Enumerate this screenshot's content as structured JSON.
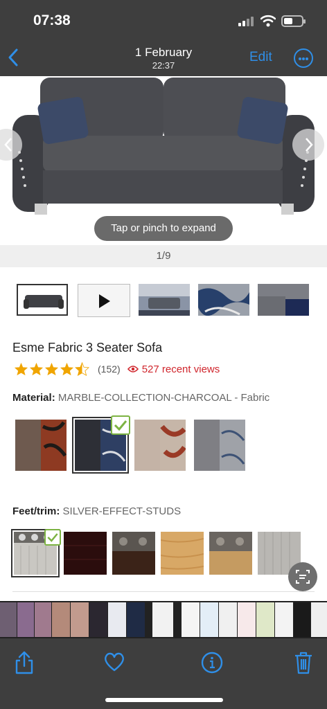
{
  "status_bar": {
    "time": "07:38"
  },
  "nav": {
    "title": "1 February",
    "subtitle": "22:37",
    "edit_label": "Edit",
    "back_icon": "chevron-left-icon",
    "more_icon": "ellipsis-circle-icon"
  },
  "viewer": {
    "expand_hint": "Tap or pinch to expand",
    "counter": "1/9",
    "thumbnails": [
      {
        "kind": "sofa-image",
        "selected": true
      },
      {
        "kind": "video",
        "selected": false
      },
      {
        "kind": "room-image",
        "selected": false
      },
      {
        "kind": "fabric-closeup",
        "selected": false
      },
      {
        "kind": "arm-closeup",
        "selected": false
      }
    ]
  },
  "product": {
    "title": "Esme Fabric 3 Seater Sofa",
    "rating": 4.5,
    "rating_max": 5,
    "review_count": "(152)",
    "recent_views": "527 recent views"
  },
  "material": {
    "label": "Material:",
    "value": "MARBLE-COLLECTION-CHARCOAL - Fabric",
    "options": [
      {
        "name": "brown-marble",
        "colors": [
          "#6e5a4f",
          "#8e3a22"
        ],
        "selected": false
      },
      {
        "name": "charcoal-marble",
        "colors": [
          "#2d2f36",
          "#2e3f63"
        ],
        "selected": true
      },
      {
        "name": "cream-marble",
        "colors": [
          "#c4b3a6",
          "#9a3a26"
        ],
        "selected": false
      },
      {
        "name": "grey-marble",
        "colors": [
          "#7f7f84",
          "#9fa2a8"
        ],
        "selected": false
      }
    ]
  },
  "feet": {
    "label": "Feet/trim:",
    "value": "SILVER-EFFECT-STUDS",
    "options": [
      {
        "name": "silver-studs",
        "colors": [
          "#c9c7c2",
          "#b8b5af"
        ],
        "selected": true
      },
      {
        "name": "dark-wood",
        "colors": [
          "#2b0d0d",
          "#3a1414"
        ],
        "selected": false
      },
      {
        "name": "bronze-studs-dark",
        "colors": [
          "#5a5550",
          "#3b2318"
        ],
        "selected": false
      },
      {
        "name": "light-oak",
        "colors": [
          "#d8a866",
          "#c8914d"
        ],
        "selected": false
      },
      {
        "name": "bronze-studs-oak",
        "colors": [
          "#6a6560",
          "#c59b61"
        ],
        "selected": false
      },
      {
        "name": "grey-wood",
        "colors": [
          "#b9b7b3",
          "#a4a29e"
        ],
        "selected": false
      }
    ]
  },
  "toolbar": {
    "share_icon": "share-icon",
    "favorite_icon": "heart-icon",
    "info_icon": "info-icon",
    "delete_icon": "trash-icon"
  },
  "colors": {
    "accent": "#2f8fe8",
    "views_red": "#d0262d",
    "star": "#f0a500",
    "check_green": "#7cb342"
  }
}
